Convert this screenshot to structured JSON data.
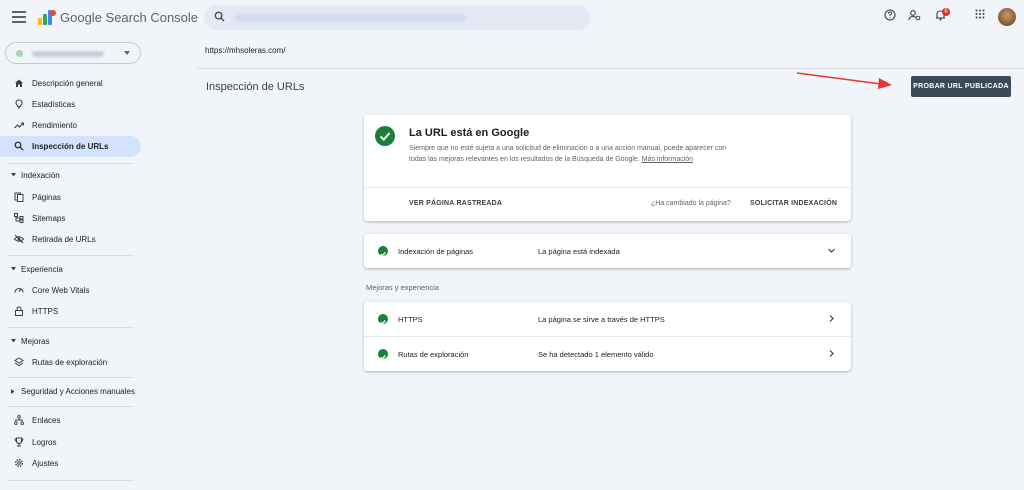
{
  "header": {
    "app_title": "Google Search Console",
    "icons": [
      "menu-icon",
      "search-console-logo",
      "search-icon",
      "help-icon",
      "manage-users-icon",
      "notifications-icon",
      "apps-grid-icon",
      "avatar"
    ],
    "notification_count": "6"
  },
  "sidebar": {
    "items_top": [
      {
        "label": "Descripción general",
        "icon": "home-icon"
      },
      {
        "label": "Estadísticas",
        "icon": "lightbulb-icon"
      },
      {
        "label": "Rendimiento",
        "icon": "trending-up-icon"
      },
      {
        "label": "Inspección de URLs",
        "icon": "search-icon",
        "active": true
      }
    ],
    "indexacion": {
      "title": "Indexación",
      "items": [
        {
          "label": "Páginas",
          "icon": "pages-icon"
        },
        {
          "label": "Sitemaps",
          "icon": "sitemap-icon"
        },
        {
          "label": "Retirada de URLs",
          "icon": "eye-off-icon"
        }
      ]
    },
    "experiencia": {
      "title": "Experiencia",
      "items": [
        {
          "label": "Core Web Vitals",
          "icon": "gauge-icon"
        },
        {
          "label": "HTTPS",
          "icon": "lock-icon"
        }
      ]
    },
    "mejoras": {
      "title": "Mejoras",
      "items": [
        {
          "label": "Rutas de exploración",
          "icon": "layers-icon"
        }
      ]
    },
    "seguridad": {
      "title": "Seguridad y Acciones manuales"
    },
    "items_bottom": [
      {
        "label": "Enlaces",
        "icon": "links-icon"
      },
      {
        "label": "Logros",
        "icon": "trophy-icon"
      },
      {
        "label": "Ajustes",
        "icon": "settings-icon"
      }
    ]
  },
  "main": {
    "property_url": "https://mhsoleras.com/",
    "page_title": "Inspección de URLs",
    "test_button": "PROBAR URL PUBLICADA",
    "status_card": {
      "title": "La URL está en Google",
      "description": "Siempre que no esté sujeta a una solicitud de eliminación o a una acción manual, puede aparecer con todas las mejoras relevantes en los resultados de la Búsqueda de Google.",
      "more_link": "Más información",
      "view_crawled": "VER PÁGINA RASTREADA",
      "changed_question": "¿Ha cambiado la página?",
      "request_indexing": "SOLICITAR INDEXACIÓN"
    },
    "indexing_row": {
      "name": "Indexación de páginas",
      "value": "La página está indexada"
    },
    "section_label": "Mejoras y experiencia",
    "experience_rows": [
      {
        "name": "HTTPS",
        "value": "La página se sirve a través de HTTPS"
      },
      {
        "name": "Rutas de exploración",
        "value": "Se ha detectado 1 elemento válido"
      }
    ]
  },
  "colors": {
    "background": "#f1f4f9",
    "active_nav": "#d3e3fd",
    "success_green": "#188038",
    "button_dark": "#3c4a57",
    "annotation_arrow": "#e53935"
  }
}
